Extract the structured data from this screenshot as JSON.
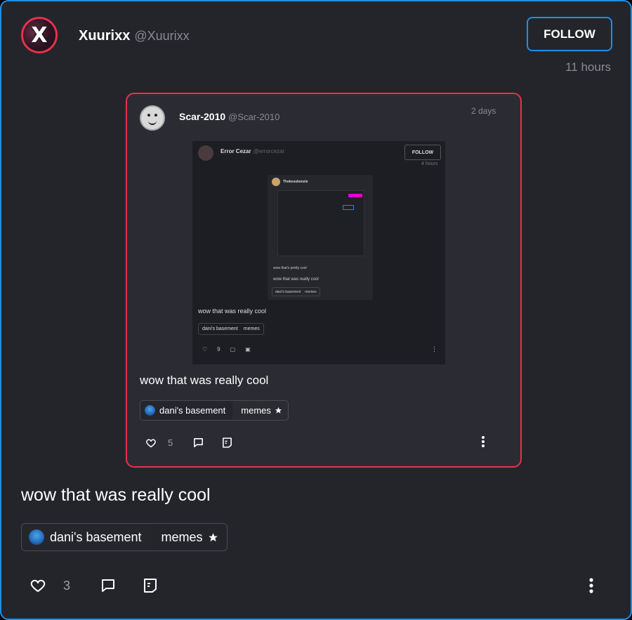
{
  "post": {
    "author_initial": "X",
    "author_name": "Xuurixx",
    "author_handle": "@Xuurixx",
    "follow_label": "FOLLOW",
    "time": "11 hours",
    "text": "wow that was really cool",
    "tags": {
      "community": "dani's basement",
      "category": "memes"
    },
    "likes": "3"
  },
  "quoted": {
    "author_name": "Scar-2010",
    "author_handle": "@Scar-2010",
    "time": "2 days",
    "text": "wow that was really cool",
    "tags": {
      "community": "dani's basement",
      "category": "memes"
    },
    "likes": "5",
    "screenshot": {
      "author_name": "Error Cezar",
      "author_handle": "@errorcezar",
      "follow_label": "FOLLOW",
      "time": "4 hours",
      "inner_author": "Thekessbenzie",
      "inner_text_small": "wow that's pretty cool",
      "inner_text": "wow that was really cool",
      "inner_tags": {
        "community": "dani's basement",
        "category": "memes"
      },
      "text": "wow that was really cool",
      "tags": {
        "community": "dani's basement",
        "category": "memes"
      },
      "likes": "9"
    }
  },
  "colors": {
    "accent": "#1e8fe6",
    "quote_border": "#e8304a",
    "background": "#24252b"
  },
  "icons": [
    "heart-icon",
    "comment-icon",
    "quote-repost-icon",
    "more-vertical-icon",
    "star-icon"
  ]
}
